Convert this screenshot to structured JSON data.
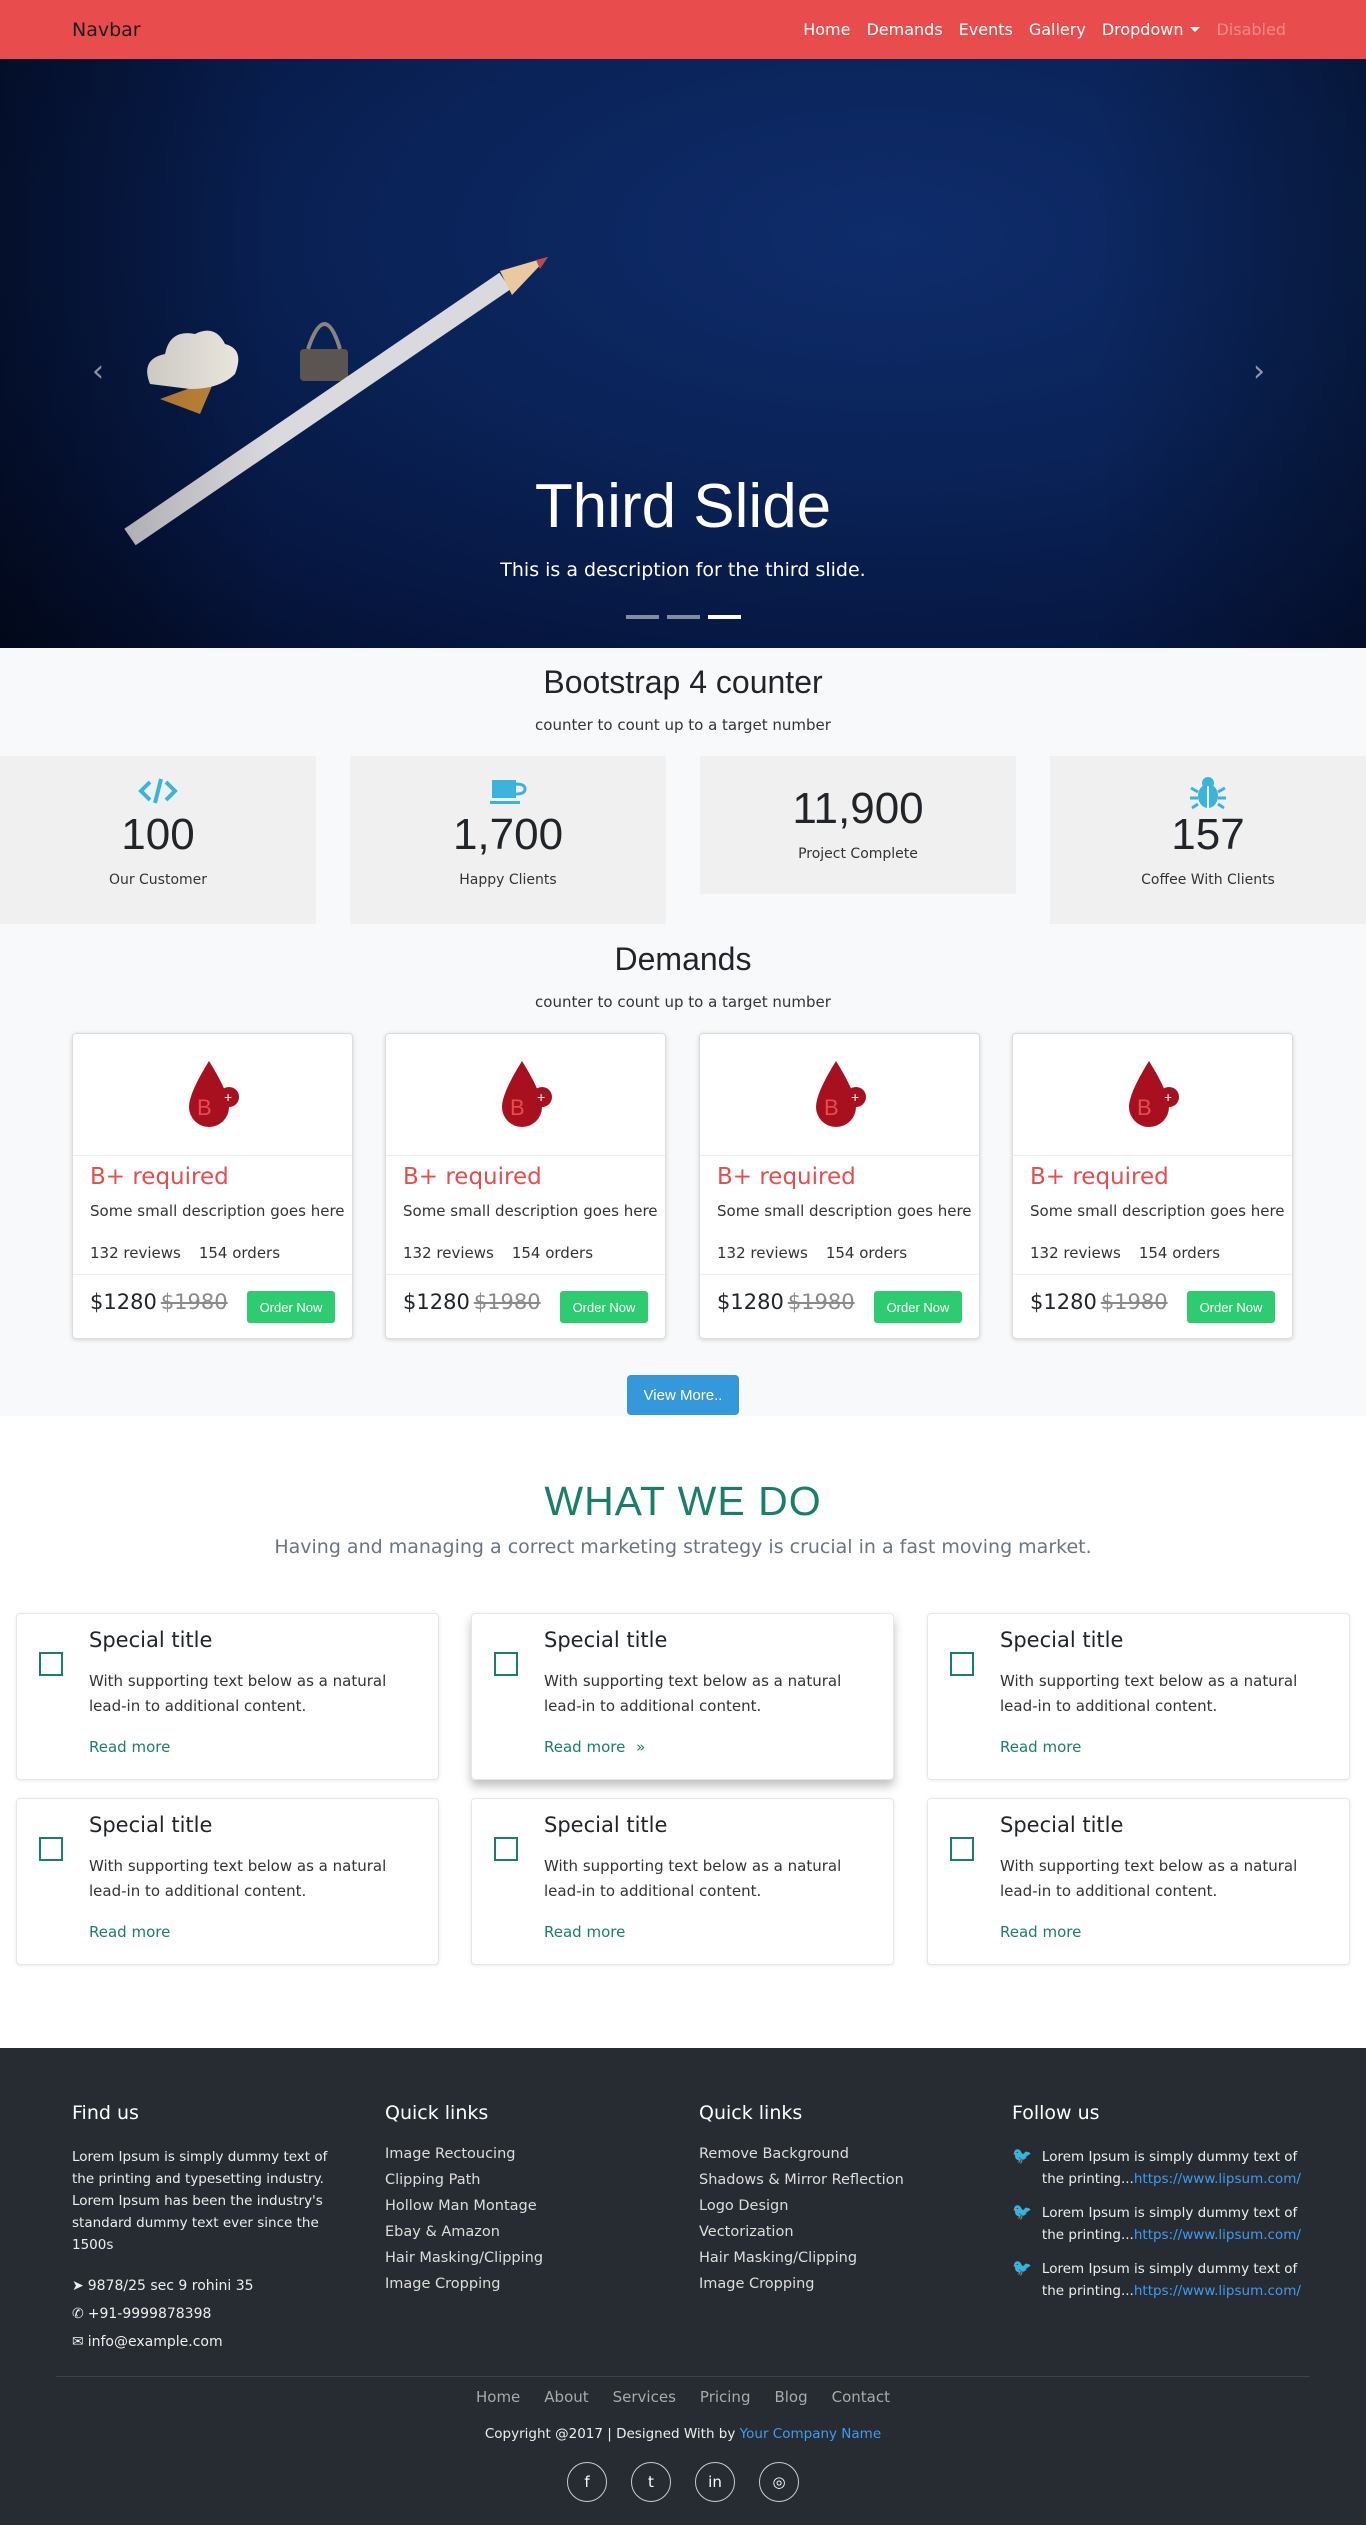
{
  "navbar": {
    "brand": "Navbar",
    "links": [
      "Home",
      "Demands",
      "Events",
      "Gallery",
      "Dropdown",
      "Disabled"
    ]
  },
  "hero": {
    "title": "Third Slide",
    "description": "This is a description for the third slide.",
    "prev_icon": "chevron-left-icon",
    "next_icon": "chevron-right-icon"
  },
  "counter": {
    "title": "Bootstrap 4 counter",
    "subtitle": "counter to count up to a target number",
    "items": [
      {
        "value": "100",
        "label": "Our Customer",
        "icon": "code-icon"
      },
      {
        "value": "1,700",
        "label": "Happy Clients",
        "icon": "coffee-cup-icon"
      },
      {
        "value": "11,900",
        "label": "Project Complete",
        "icon": ""
      },
      {
        "value": "157",
        "label": "Coffee With Clients",
        "icon": "bug-icon"
      }
    ]
  },
  "demands": {
    "title": "Demands",
    "subtitle": "counter to count up to a target number",
    "cards": [
      {
        "title": "B+ required",
        "description": "Some small description goes here",
        "reviews": "132 reviews",
        "orders": "154 orders",
        "price": "$1280",
        "old_price": "$1980",
        "button": "Order Now"
      },
      {
        "title": "B+ required",
        "description": "Some small description goes here",
        "reviews": "132 reviews",
        "orders": "154 orders",
        "price": "$1280",
        "old_price": "$1980",
        "button": "Order Now"
      },
      {
        "title": "B+ required",
        "description": "Some small description goes here",
        "reviews": "132 reviews",
        "orders": "154 orders",
        "price": "$1280",
        "old_price": "$1980",
        "button": "Order Now"
      },
      {
        "title": "B+ required",
        "description": "Some small description goes here",
        "reviews": "132 reviews",
        "orders": "154 orders",
        "price": "$1280",
        "old_price": "$1980",
        "button": "Order Now"
      }
    ],
    "view_more": "View More.."
  },
  "what_we_do": {
    "title": "WHAT WE DO",
    "subtitle": "Having and managing a correct marketing strategy is crucial in a fast moving market.",
    "cards": [
      {
        "title": "Special title",
        "text": "With supporting text below as a natural lead-in to additional content.",
        "link": "Read more"
      },
      {
        "title": "Special title",
        "text": "With supporting text below as a natural lead-in to additional content.",
        "link": "Read more"
      },
      {
        "title": "Special title",
        "text": "With supporting text below as a natural lead-in to additional content.",
        "link": "Read more"
      },
      {
        "title": "Special title",
        "text": "With supporting text below as a natural lead-in to additional content.",
        "link": "Read more"
      },
      {
        "title": "Special title",
        "text": "With supporting text below as a natural lead-in to additional content.",
        "link": "Read more"
      },
      {
        "title": "Special title",
        "text": "With supporting text below as a natural lead-in to additional content.",
        "link": "Read more"
      }
    ]
  },
  "footer": {
    "find_us": {
      "title": "Find us",
      "text": "Lorem Ipsum is simply dummy text of the printing and typesetting industry. Lorem Ipsum has been the industry's standard dummy text ever since the 1500s",
      "address": "9878/25 sec 9 rohini 35",
      "phone": "+91-9999878398",
      "email": "info@example.com"
    },
    "quick_links_1": {
      "title": "Quick links",
      "items": [
        "Image Rectoucing",
        "Clipping Path",
        "Hollow Man Montage",
        "Ebay & Amazon",
        "Hair Masking/Clipping",
        "Image Cropping"
      ]
    },
    "quick_links_2": {
      "title": "Quick links",
      "items": [
        "Remove Background",
        "Shadows & Mirror Reflection",
        "Logo Design",
        "Vectorization",
        "Hair Masking/Clipping",
        "Image Cropping"
      ]
    },
    "follow_us": {
      "title": "Follow us",
      "tweets": [
        {
          "text": "Lorem Ipsum is simply dummy text of the printing...",
          "link": "https://www.lipsum.com/"
        },
        {
          "text": "Lorem Ipsum is simply dummy text of the printing...",
          "link": "https://www.lipsum.com/"
        },
        {
          "text": "Lorem Ipsum is simply dummy text of the printing...",
          "link": "https://www.lipsum.com/"
        }
      ]
    },
    "nav": [
      "Home",
      "About",
      "Services",
      "Pricing",
      "Blog",
      "Contact"
    ],
    "copyright": "Copyright @2017 | Designed With by",
    "company": "Your Company Name",
    "social": [
      "f",
      "twitter",
      "in",
      "instagram"
    ]
  },
  "colors": {
    "navbar": "#e84c4c",
    "accent_green": "#1a7f6a",
    "order_button": "#2ecc71",
    "view_more": "#3498db",
    "footer": "#262c31"
  }
}
